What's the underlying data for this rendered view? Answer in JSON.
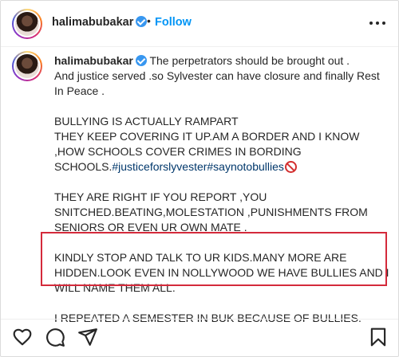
{
  "post": {
    "username": "halimabubakar",
    "dot": "•",
    "follow_label": "Follow",
    "verified": true
  },
  "caption": {
    "username": "halimabubakar",
    "paragraphs": {
      "p1": "The perpetrators should be brought out .\nAnd justice served .so Sylvester can have closure and finally Rest In Peace .",
      "p2_text": "BULLYING IS ACTUALLY RAMPART\nTHEY KEEP COVERING IT UP.AM A BORDER AND I KNOW ,HOW SCHOOLS COVER CRIMES IN BORDING SCHOOLS.",
      "p2_hashtags": "#justiceforslyvester#saynotobullies",
      "p3": "THEY ARE RIGHT IF YOU REPORT ,YOU SNITCHED.BEATING,MOLESTATION ,PUNISHMENTS FROM SENIORS OR EVEN UR OWN MATE .",
      "p4": "KINDLY STOP AND TALK TO UR KIDS.MANY MORE ARE HIDDEN.LOOK EVEN IN NOLLYWOOD WE HAVE BULLIES AND I WILL NAME THEM ALL.",
      "p5": "I REPEATED A SEMESTER IN BUK BECAUSE OF BULLIES."
    },
    "emoji": "no-entry-sign-icon"
  },
  "actions": [
    "heart-icon",
    "comment-icon",
    "share-icon",
    "bookmark-icon"
  ],
  "colors": {
    "follow": "#0095f6",
    "hashtag": "#00376b",
    "verified": "#3897f0",
    "highlight_border": "#d42a3b",
    "text": "#262626"
  }
}
